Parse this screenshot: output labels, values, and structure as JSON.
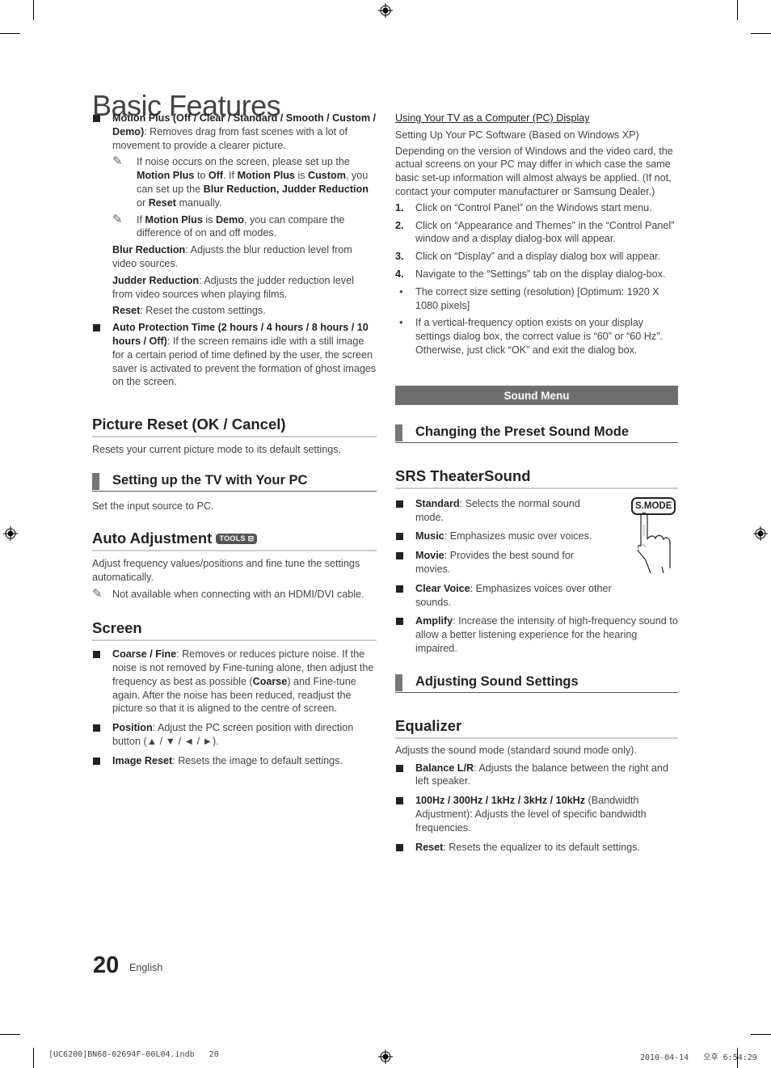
{
  "page": {
    "title": "Basic Features",
    "page_number": "20",
    "language": "English",
    "slug_left": "[UC6200]BN68-02694F-00L04.indb   20",
    "slug_right": "2010-04-14   오후 6:54:29"
  },
  "left": {
    "motion_plus": {
      "title": "Motion Plus (Off / Clear / Standard / Smooth / Custom / Demo)",
      "text": ": Removes drag from fast scenes with a lot of movement to provide a clearer picture.",
      "note1": {
        "t1": "If noise occurs on the screen, please set up the ",
        "b1": "Motion Plus",
        "t2": " to ",
        "b2": "Off",
        "t3": ". If ",
        "b3": "Motion Plus",
        "t4": " is ",
        "b4": "Custom",
        "t5": ", you can set up the ",
        "b5": "Blur Reduction, Judder Reduction",
        "t6": " or ",
        "b6": "Reset",
        "t7": " manually."
      },
      "note2": {
        "t1": "If ",
        "b1": "Motion Plus",
        "t2": " is ",
        "b2": "Demo",
        "t3": ", you can compare the difference of on and off modes."
      },
      "blur": {
        "label": "Blur Reduction",
        "text": ": Adjusts the blur reduction level from video sources."
      },
      "judder": {
        "label": "Judder Reduction",
        "text": ": Adjusts the judder reduction level from video sources when playing films."
      },
      "reset": {
        "label": "Reset",
        "text": ": Reset the custom settings."
      }
    },
    "auto_protection": {
      "title": "Auto Protection Time (2 hours / 4 hours / 8 hours / 10 hours / Off)",
      "text": ": If the screen remains idle with a still image for a certain period of time defined by the user, the screen saver is activated to prevent the formation of ghost images on the screen."
    },
    "picture_reset": {
      "heading": "Picture Reset (OK / Cancel)",
      "text": "Resets your current picture mode to its default settings."
    },
    "setting_up_pc": {
      "heading": "Setting up the TV with Your PC",
      "text": "Set the input source to PC."
    },
    "auto_adjustment": {
      "heading": "Auto Adjustment",
      "badge": "TOOLS",
      "badge_icon": "tools-icon",
      "text": "Adjust frequency values/positions and fine tune the settings automatically.",
      "note": "Not available when connecting with an HDMI/DVI cable."
    },
    "screen": {
      "heading": "Screen",
      "items": [
        {
          "label": "Coarse / Fine",
          "text1": ": Removes or reduces picture noise. If the noise is not removed by Fine-tuning alone, then adjust the frequency as best as possible (",
          "bold": "Coarse",
          "text2": ") and Fine-tune again. After the noise has been reduced, readjust the picture so that it is aligned to the centre of screen."
        },
        {
          "label": "Position",
          "text1": ": Adjust the PC screen position with direction button (▲ / ▼ / ◄ / ►).",
          "bold": "",
          "text2": ""
        },
        {
          "label": "Image Reset",
          "text1": ": Resets the image to default settings.",
          "bold": "",
          "text2": ""
        }
      ]
    }
  },
  "right": {
    "pc_display": {
      "heading": "Using Your TV as a Computer (PC) Display",
      "subheading": "Setting Up Your PC Software (Based on Windows XP)",
      "intro": "Depending on the version of Windows and the video card, the actual screens on your PC may differ in which case the same basic set-up information will almost always be applied. (If not, contact your computer manufacturer or Samsung Dealer.)",
      "steps": [
        {
          "n": "1.",
          "text": "Click on “Control Panel” on the Windows start menu."
        },
        {
          "n": "2.",
          "text": "Click on “Appearance and Themes” in the “Control Panel” window and a display dialog-box will appear."
        },
        {
          "n": "3.",
          "text": "Click on “Display” and a display dialog box will appear."
        },
        {
          "n": "4.",
          "text": "Navigate to the “Settings” tab on the display dialog-box."
        }
      ],
      "bullets": [
        "The correct size setting (resolution) [Optimum: 1920 X 1080 pixels]",
        "If a vertical-frequency option exists on your display settings dialog box, the correct value is “60” or “60 Hz”. Otherwise, just click “OK” and exit the dialog box."
      ]
    },
    "sound_menu": {
      "band": "Sound Menu"
    },
    "preset_sound": {
      "heading": "Changing the Preset Sound Mode"
    },
    "srs": {
      "heading": "SRS TheaterSound",
      "button_label": "S.MODE",
      "items": [
        {
          "label": "Standard",
          "text": ": Selects the normal sound mode."
        },
        {
          "label": "Music",
          "text": ": Emphasizes music over voices."
        },
        {
          "label": "Movie",
          "text": ": Provides the best sound for movies."
        },
        {
          "label": "Clear Voice",
          "text": ": Emphasizes voices over other sounds."
        },
        {
          "label": "Amplify",
          "text": ": Increase the intensity of high-frequency sound to allow a better listening experience for the hearing impaired."
        }
      ]
    },
    "adjusting_sound": {
      "heading": "Adjusting Sound Settings"
    },
    "equalizer": {
      "heading": "Equalizer",
      "text": "Adjusts the sound mode (standard sound mode only).",
      "items": [
        {
          "label": "Balance L/R",
          "text": ": Adjusts the balance between the right and left speaker."
        },
        {
          "label": "100Hz / 300Hz / 1kHz / 3kHz / 10kHz",
          "text": " (Bandwidth Adjustment): Adjusts the level of specific bandwidth frequencies."
        },
        {
          "label": "Reset",
          "text": ": Resets the equalizer to its default settings."
        }
      ]
    }
  }
}
